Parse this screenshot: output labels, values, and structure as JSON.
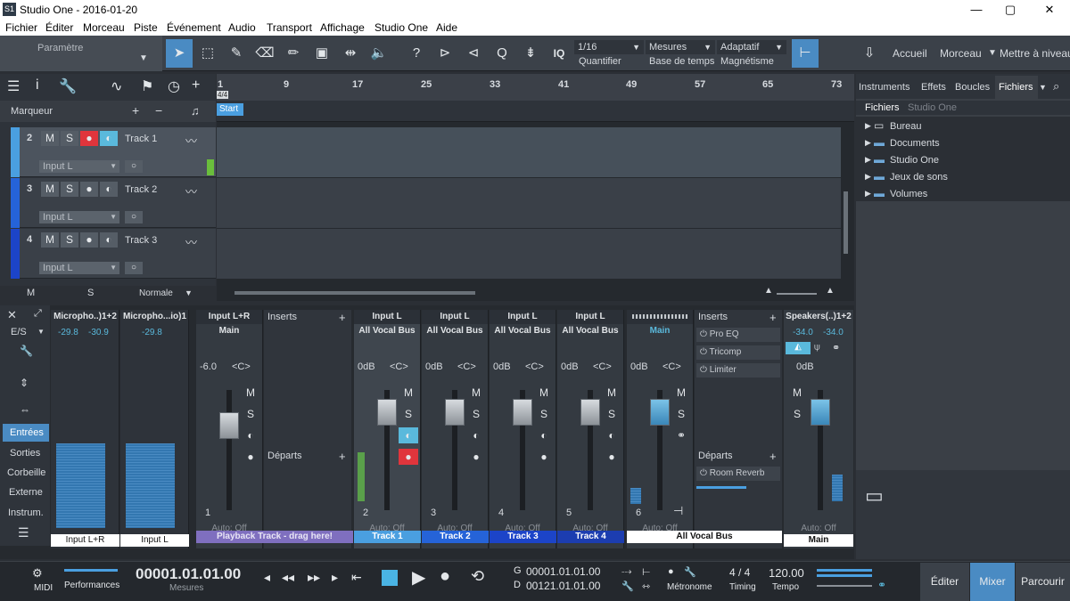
{
  "window": {
    "title": "Studio One - 2016-01-20",
    "minimize": "—",
    "maximize": "▢",
    "close": "✕",
    "logo": "S1"
  },
  "menu": [
    "Fichier",
    "Éditer",
    "Morceau",
    "Piste",
    "Événement",
    "Audio",
    "Transport",
    "Affichage",
    "Studio One",
    "Aide"
  ],
  "toolbar": {
    "param_label": "Paramètre",
    "quantize": "1/16",
    "quantize_label": "Quantifier",
    "timebase": "Mesures",
    "timebase_label": "Base de temps",
    "snap": "Adaptatif",
    "snap_label": "Magnétisme",
    "nav": [
      "Accueil",
      "Morceau",
      "Mettre à niveau"
    ]
  },
  "arrange": {
    "marker_label": "Marqueur",
    "start_label": "Start",
    "timesig": "4/4",
    "ruler": [
      "1",
      "9",
      "17",
      "25",
      "33",
      "41",
      "49",
      "57",
      "65",
      "73"
    ],
    "footer_m": "M",
    "footer_s": "S",
    "footer_mode": "Normale",
    "tracks": [
      {
        "num": "2",
        "name": "Track 1",
        "input": "Input L",
        "color": "#4a9fe0"
      },
      {
        "num": "3",
        "name": "Track 2",
        "input": "Input L",
        "color": "#2563d8"
      },
      {
        "num": "4",
        "name": "Track 3",
        "input": "Input L",
        "color": "#1c44c8"
      }
    ]
  },
  "browser": {
    "tabs": [
      "Instruments",
      "Effets",
      "Boucles",
      "Fichiers"
    ],
    "subtabs": [
      "Fichiers",
      "Studio One"
    ],
    "items": [
      "Bureau",
      "Documents",
      "Studio One",
      "Jeux de sons",
      "Volumes"
    ]
  },
  "mixer": {
    "side": [
      "E/S",
      "Entrées",
      "Sorties",
      "Corbeille",
      "Externe",
      "Instrum."
    ],
    "inputs": [
      {
        "name": "Micropho..)1+2",
        "val1": "-29.8",
        "val2": "-30.9",
        "label": "Input L+R"
      },
      {
        "name": "Micropho...io)1",
        "val1": "-29.8",
        "val2": "",
        "label": "Input L"
      }
    ],
    "inserts_label": "Inserts",
    "departs_label": "Départs",
    "auto_label": "Auto: Off",
    "strips": [
      {
        "name": "Input L+R",
        "route": "Main",
        "vol": "-6.0",
        "pan": "<C>",
        "num": "1",
        "label": "Playback Track - drag here!",
        "color": "#7f6fbf"
      },
      {
        "name": "Input L",
        "route": "All Vocal Bus",
        "vol": "0dB",
        "pan": "<C>",
        "num": "2",
        "label": "Track 1",
        "color": "#4a9fe0"
      },
      {
        "name": "Input L",
        "route": "All Vocal Bus",
        "vol": "0dB",
        "pan": "<C>",
        "num": "3",
        "label": "Track 2",
        "color": "#2563d8"
      },
      {
        "name": "Input L",
        "route": "All Vocal Bus",
        "vol": "0dB",
        "pan": "<C>",
        "num": "4",
        "label": "Track 3",
        "color": "#1c44c8"
      },
      {
        "name": "Input L",
        "route": "All Vocal Bus",
        "vol": "0dB",
        "pan": "<C>",
        "num": "5",
        "label": "Track 4",
        "color": "#1c3db0"
      },
      {
        "name": "",
        "route": "Main",
        "vol": "0dB",
        "pan": "<C>",
        "num": "6",
        "label": "All Vocal Bus",
        "color": "#ffffff"
      }
    ],
    "bus_inserts": [
      "Pro EQ",
      "Tricomp",
      "Limiter"
    ],
    "bus_send": "Room Reverb",
    "main": {
      "name": "Speakers(..)1+2",
      "val1": "-34.0",
      "val2": "-34.0",
      "vol": "0dB",
      "label": "Main"
    }
  },
  "transport": {
    "midi": "MIDI",
    "perf": "Performances",
    "time": "00001.01.01.00",
    "time_label": "Mesures",
    "g_label": "G",
    "g_val": "00001.01.01.00",
    "d_label": "D",
    "d_val": "00121.01.01.00",
    "metro": "Métronome",
    "timing": "4 / 4",
    "timing_label": "Timing",
    "tempo": "120.00",
    "tempo_label": "Tempo",
    "views": [
      "Éditer",
      "Mixer",
      "Parcourir"
    ]
  }
}
